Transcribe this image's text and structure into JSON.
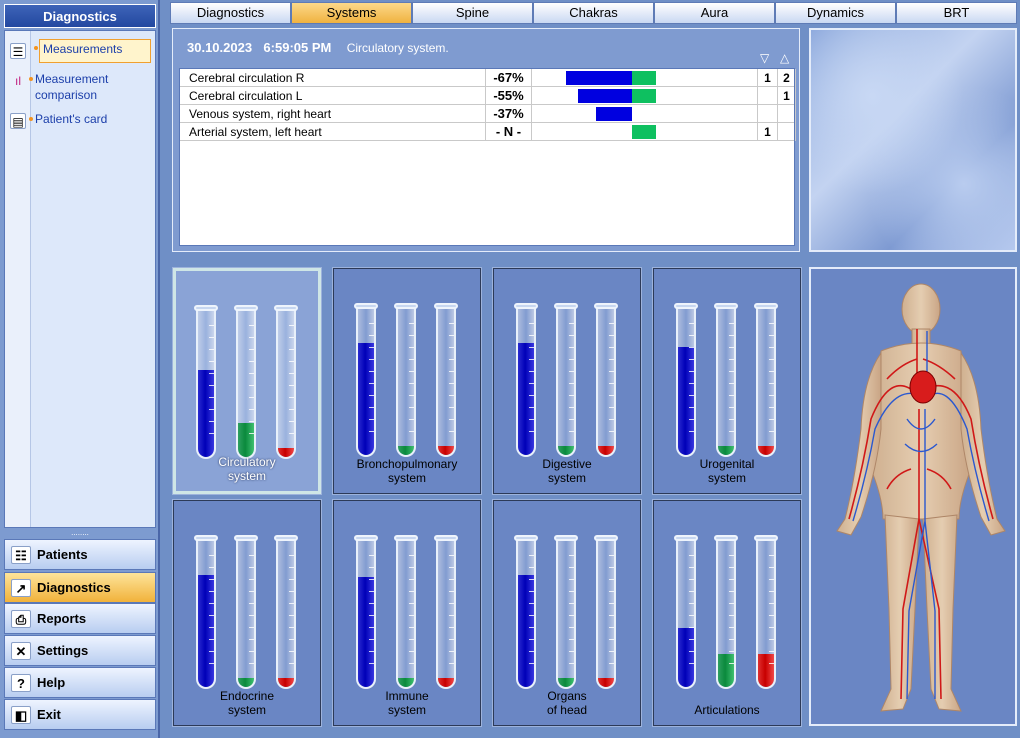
{
  "sidebar": {
    "title": "Diagnostics",
    "links": [
      {
        "label": "Measurements"
      },
      {
        "label": "Measurement comparison"
      },
      {
        "label": "Patient's card"
      }
    ],
    "grip": "........",
    "nav": [
      {
        "label": "Patients",
        "icon": "patients-icon"
      },
      {
        "label": "Diagnostics",
        "icon": "diagnostics-icon",
        "active": true
      },
      {
        "label": "Reports",
        "icon": "reports-icon"
      },
      {
        "label": "Settings",
        "icon": "settings-icon"
      },
      {
        "label": "Help",
        "icon": "help-icon"
      },
      {
        "label": "Exit",
        "icon": "exit-icon"
      }
    ]
  },
  "tabs": [
    "Diagnostics",
    "Systems",
    "Spine",
    "Chakras",
    "Aura",
    "Dynamics",
    "BRT"
  ],
  "active_tab": "Systems",
  "info": {
    "date": "30.10.2023",
    "time": "6:59:05 PM",
    "system": "Circulatory system.",
    "down_arrow": "▽",
    "up_arrow": "△",
    "rows": [
      {
        "name": "Cerebral circulation R",
        "pct": "-67%",
        "neg": 0.67,
        "pos": true,
        "d": "1",
        "u": "2"
      },
      {
        "name": "Cerebral circulation L",
        "pct": "-55%",
        "neg": 0.55,
        "pos": true,
        "d": "",
        "u": "1"
      },
      {
        "name": "Venous system, right heart",
        "pct": "-37%",
        "neg": 0.37,
        "pos": false,
        "d": "",
        "u": ""
      },
      {
        "name": "Arterial system, left heart",
        "pct": "- N -",
        "neg": 0,
        "pos": true,
        "d": "1",
        "u": ""
      }
    ]
  },
  "systems": [
    {
      "label1": "Circulatory",
      "label2": "system",
      "active": true,
      "blue": 0.59,
      "green": 0.23,
      "red": 0.06
    },
    {
      "label1": "Bronchopulmonary",
      "label2": "system",
      "blue": 0.76,
      "green": 0.06,
      "red": 0.06
    },
    {
      "label1": "Digestive",
      "label2": "system",
      "blue": 0.76,
      "green": 0.06,
      "red": 0.06
    },
    {
      "label1": "Urogenital",
      "label2": "system",
      "blue": 0.73,
      "green": 0.06,
      "red": 0.06
    },
    {
      "label1": "Endocrine",
      "label2": "system",
      "blue": 0.76,
      "green": 0.06,
      "red": 0.06
    },
    {
      "label1": "Immune",
      "label2": "system",
      "blue": 0.74,
      "green": 0.06,
      "red": 0.06
    },
    {
      "label1": "Organs",
      "label2": "of head",
      "blue": 0.76,
      "green": 0.06,
      "red": 0.06
    },
    {
      "label1": "Articulations",
      "label2": "",
      "blue": 0.4,
      "green": 0.22,
      "red": 0.22
    }
  ],
  "colors": {
    "accent": "#f1b23b",
    "blue": "#0000e0",
    "green": "#0ec060",
    "red": "#c80000"
  }
}
